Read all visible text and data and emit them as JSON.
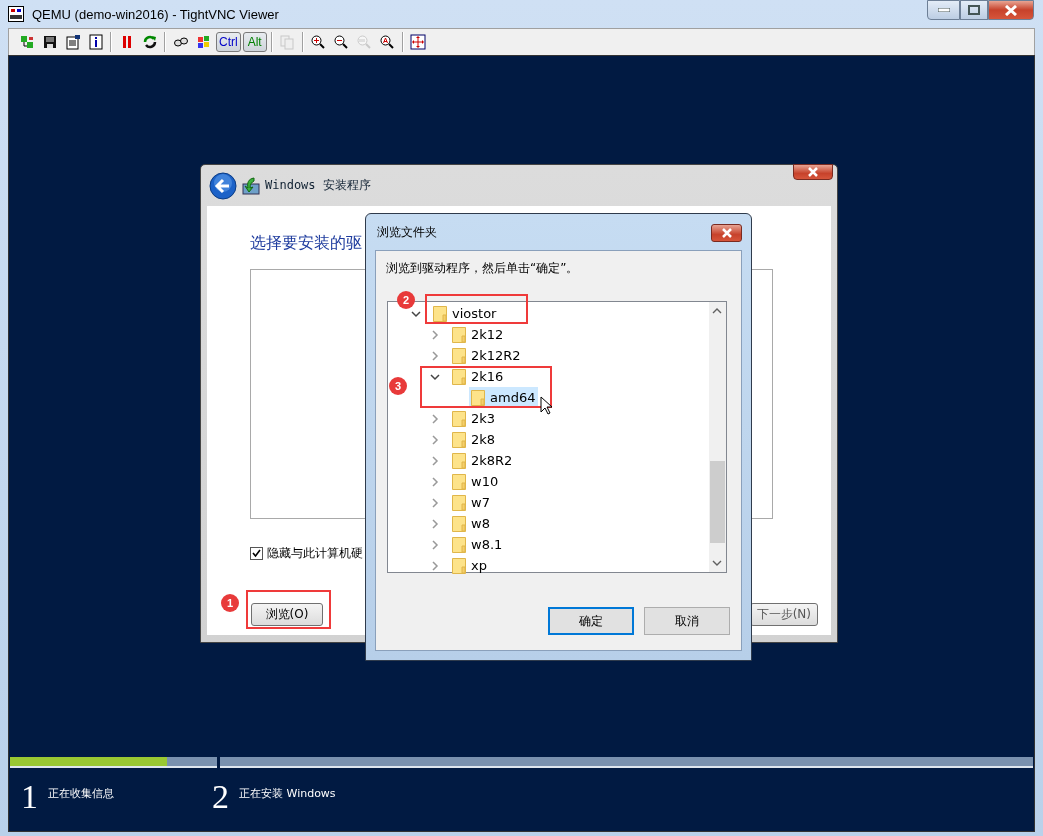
{
  "window": {
    "title": "QEMU (demo-win2016) - TightVNC Viewer"
  },
  "toolbar": {
    "items": [
      {
        "kind": "icon",
        "disabled": false
      },
      {
        "kind": "icon",
        "disabled": false
      },
      {
        "kind": "icon",
        "disabled": false
      },
      {
        "kind": "icon",
        "disabled": false
      },
      {
        "kind": "separator"
      },
      {
        "kind": "icon",
        "disabled": false
      },
      {
        "kind": "icon",
        "disabled": false
      },
      {
        "kind": "separator"
      },
      {
        "kind": "icon",
        "disabled": false
      },
      {
        "kind": "icon",
        "disabled": false
      },
      {
        "kind": "key",
        "label": "Ctrl",
        "color": "#0000c8"
      },
      {
        "kind": "key",
        "label": "Alt",
        "color": "#008000"
      },
      {
        "kind": "separator"
      },
      {
        "kind": "icon",
        "disabled": true
      },
      {
        "kind": "separator"
      },
      {
        "kind": "icon",
        "disabled": false
      },
      {
        "kind": "icon",
        "disabled": false
      },
      {
        "kind": "icon",
        "disabled": true
      },
      {
        "kind": "icon",
        "disabled": false
      },
      {
        "kind": "separator"
      },
      {
        "kind": "icon",
        "disabled": false
      }
    ]
  },
  "setup_dialog": {
    "title": "Windows 安装程序",
    "heading": "选择要安装的驱",
    "hide_incompatible": {
      "label": "隐藏与此计算机硬",
      "checked": true
    },
    "browse_button": {
      "label": "浏览(O)",
      "callout": "1"
    },
    "next_button": {
      "label": "下一步(N)"
    }
  },
  "browse_dialog": {
    "title": "浏览文件夹",
    "instruction": "浏览到驱动程序，然后单击“确定”。",
    "tree": [
      {
        "name": "viostor",
        "expanded": true,
        "selected": false,
        "callout": "2",
        "children": [
          {
            "name": "2k12",
            "expanded": false,
            "selected": false
          },
          {
            "name": "2k12R2",
            "expanded": false,
            "selected": false
          },
          {
            "name": "2k16",
            "expanded": true,
            "selected": false,
            "branch_callout": "3",
            "children": [
              {
                "name": "amd64",
                "selected": true
              }
            ]
          },
          {
            "name": "2k3",
            "expanded": false,
            "selected": false
          },
          {
            "name": "2k8",
            "expanded": false,
            "selected": false
          },
          {
            "name": "2k8R2",
            "expanded": false,
            "selected": false
          },
          {
            "name": "w10",
            "expanded": false,
            "selected": false
          },
          {
            "name": "w7",
            "expanded": false,
            "selected": false
          },
          {
            "name": "w8",
            "expanded": false,
            "selected": false
          },
          {
            "name": "w8.1",
            "expanded": false,
            "selected": false
          },
          {
            "name": "xp",
            "expanded": false,
            "selected": false
          }
        ]
      }
    ],
    "buttons": [
      {
        "label": "确定",
        "default": true
      },
      {
        "label": "取消",
        "default": false
      }
    ]
  },
  "steps": [
    {
      "number": "1",
      "label": "正在收集信息",
      "level": 0.76
    },
    {
      "number": "2",
      "label": "正在安装 Windows"
    }
  ]
}
